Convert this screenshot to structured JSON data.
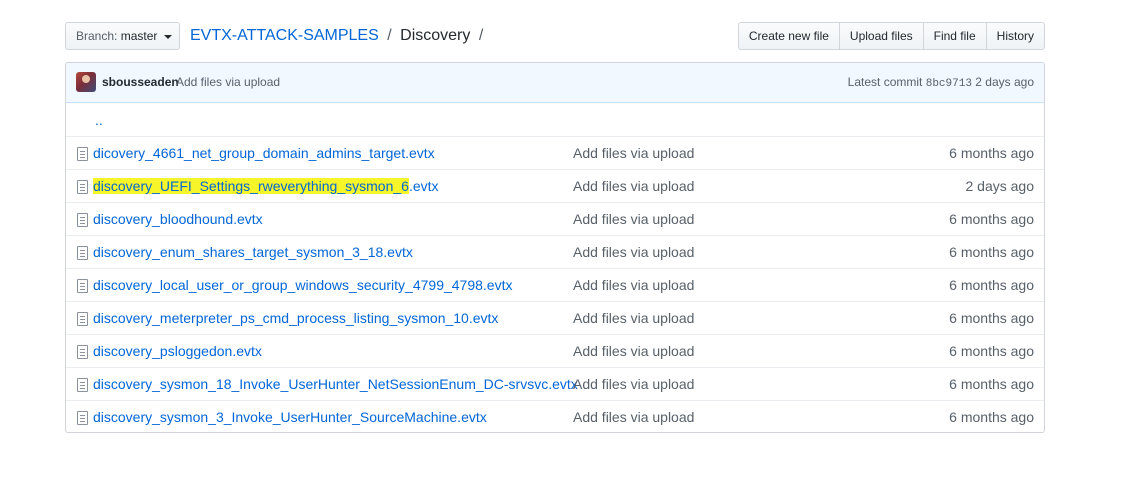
{
  "branch": {
    "label": "Branch:",
    "name": "master"
  },
  "breadcrumb": {
    "repo": "EVTX-ATTACK-SAMPLES",
    "separator": "/",
    "current": "Discovery",
    "trailing": "/"
  },
  "actions": {
    "create": "Create new file",
    "upload": "Upload files",
    "find": "Find file",
    "history": "History"
  },
  "latest_commit": {
    "author": "sbousseaden",
    "message": "Add files via upload",
    "label": "Latest commit",
    "sha": "8bc9713",
    "age": "2 days ago"
  },
  "up_link": "..",
  "files": [
    {
      "name": "dicovery_4661_net_group_domain_admins_target.evtx",
      "commit": "Add files via upload",
      "age": "6 months ago"
    },
    {
      "name_highlight": "discovery_UEFI_Settings_rweverything_sysmon_6",
      "name_rest": ".evtx",
      "commit": "Add files via upload",
      "age": "2 days ago"
    },
    {
      "name": "discovery_bloodhound.evtx",
      "commit": "Add files via upload",
      "age": "6 months ago"
    },
    {
      "name": "discovery_enum_shares_target_sysmon_3_18.evtx",
      "commit": "Add files via upload",
      "age": "6 months ago"
    },
    {
      "name": "discovery_local_user_or_group_windows_security_4799_4798.evtx",
      "commit": "Add files via upload",
      "age": "6 months ago"
    },
    {
      "name": "discovery_meterpreter_ps_cmd_process_listing_sysmon_10.evtx",
      "commit": "Add files via upload",
      "age": "6 months ago"
    },
    {
      "name": "discovery_psloggedon.evtx",
      "commit": "Add files via upload",
      "age": "6 months ago"
    },
    {
      "name": "discovery_sysmon_18_Invoke_UserHunter_NetSessionEnum_DC-srvsvc.evtx",
      "commit": "Add files via upload",
      "age": "6 months ago"
    },
    {
      "name": "discovery_sysmon_3_Invoke_UserHunter_SourceMachine.evtx",
      "commit": "Add files via upload",
      "age": "6 months ago"
    }
  ]
}
